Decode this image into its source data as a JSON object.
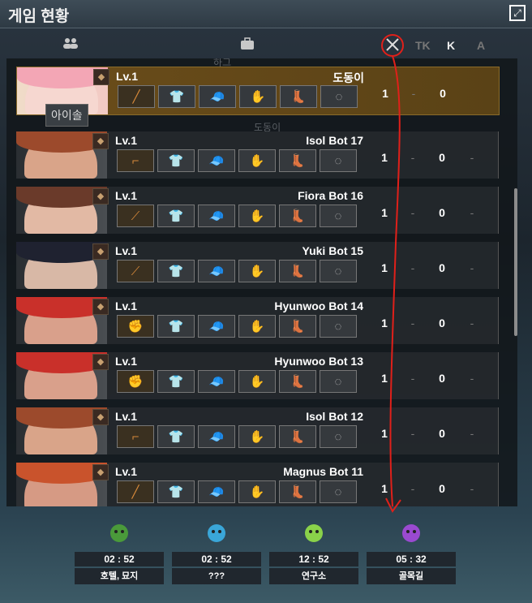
{
  "window": {
    "title": "게임 현황",
    "expand_glyph": "⤢"
  },
  "header": {
    "team_icon": "team-icon",
    "inventory_icon": "inventory-icon",
    "kills_icon": "crossed-swords-icon",
    "tk": "TK",
    "k": "K",
    "a": "A"
  },
  "tooltip": "아이솔",
  "ghost_texts": {
    "g1": "하그",
    "g2": "도동이"
  },
  "players": [
    {
      "level": "Lv.1",
      "name": "도동이",
      "tk": "1",
      "tk_dash": "-",
      "k": "0",
      "a": "",
      "highlight": true,
      "hair": "#f3a6b5",
      "face": "#f6d7d0",
      "weapon": "hammer"
    },
    {
      "level": "Lv.1",
      "name": "Isol Bot 17",
      "tk": "1",
      "tk_dash": "-",
      "k": "0",
      "a": "-",
      "highlight": false,
      "hair": "#9c4a2c",
      "face": "#d9a489",
      "weapon": "pistol"
    },
    {
      "level": "Lv.1",
      "name": "Fiora Bot 16",
      "tk": "1",
      "tk_dash": "-",
      "k": "0",
      "a": "-",
      "highlight": false,
      "hair": "#6a3a2a",
      "face": "#e2b9a4",
      "weapon": "spear"
    },
    {
      "level": "Lv.1",
      "name": "Yuki Bot 15",
      "tk": "1",
      "tk_dash": "-",
      "k": "0",
      "a": "-",
      "highlight": false,
      "hair": "#1f2230",
      "face": "#d8b8a6",
      "weapon": "sword"
    },
    {
      "level": "Lv.1",
      "name": "Hyunwoo Bot 14",
      "tk": "1",
      "tk_dash": "-",
      "k": "0",
      "a": "-",
      "highlight": false,
      "hair": "#c9302a",
      "face": "#d9a08b",
      "weapon": "glove"
    },
    {
      "level": "Lv.1",
      "name": "Hyunwoo Bot 13",
      "tk": "1",
      "tk_dash": "-",
      "k": "0",
      "a": "-",
      "highlight": false,
      "hair": "#c9302a",
      "face": "#d9a08b",
      "weapon": "gauntlet"
    },
    {
      "level": "Lv.1",
      "name": "Isol Bot 12",
      "tk": "1",
      "tk_dash": "-",
      "k": "0",
      "a": "-",
      "highlight": false,
      "hair": "#9c4a2c",
      "face": "#d9a489",
      "weapon": "pistol"
    },
    {
      "level": "Lv.1",
      "name": "Magnus Bot 11",
      "tk": "1",
      "tk_dash": "-",
      "k": "0",
      "a": "-",
      "highlight": false,
      "hair": "#c9532c",
      "face": "#d69a84",
      "weapon": "hammer"
    }
  ],
  "slot_icons": [
    "shirt-icon",
    "cap-icon",
    "hand-icon",
    "boot-icon",
    "accessory-icon"
  ],
  "zones": [
    {
      "time": "02 : 52",
      "name": "호텔, 묘지",
      "icon": "leaf-icon",
      "color": "#4a9a3a"
    },
    {
      "time": "02 : 52",
      "name": "???",
      "icon": "cloud-icon",
      "color": "#3aa6d8"
    },
    {
      "time": "12 : 52",
      "name": "연구소",
      "icon": "plant-monster-icon",
      "color": "#8ad24a"
    },
    {
      "time": "05 : 32",
      "name": "골목길",
      "icon": "hooded-icon",
      "color": "#9a4ad0"
    }
  ]
}
